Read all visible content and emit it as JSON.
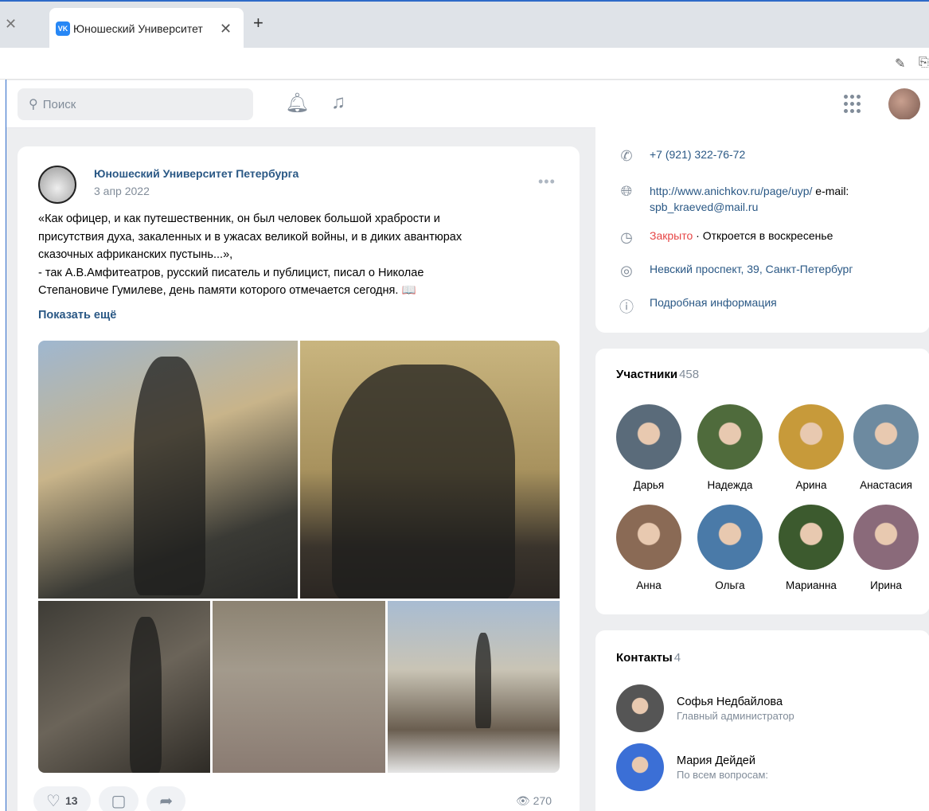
{
  "browser": {
    "tab_title": "Юношеский Университет",
    "tab_logo": "VK"
  },
  "header": {
    "search_placeholder": "Поиск"
  },
  "post": {
    "author": "Юношеский Университет Петербурга",
    "date": "3 апр 2022",
    "text_lines": [
      "«Как офицер, и как путешественник, он был человек большой храбрости и",
      "присутствия духа, закаленных и в ужасах великой войны, и в диких авантюрах",
      "сказочных африканских пустынь...»,",
      "- так А.В.Амфитеатров, русский писатель и публицист, писал о Николае",
      "Степановиче Гумилеве, день памяти которого отмечается сегодня. 📖"
    ],
    "show_more": "Показать ещё",
    "likes": "13",
    "views": "270"
  },
  "info": {
    "phone": "+7 (921) 322-76-72",
    "site": "http://www.anichkov.ru/page/uyp/",
    "email_label": " e-mail:",
    "email": "spb_kraeved@mail.ru",
    "status_closed": "Закрыто",
    "status_rest": " · Откроется в воскресенье",
    "address": "Невский проспект, 39, Санкт-Петербург",
    "more_info": "Подробная информация"
  },
  "members": {
    "title": "Участники",
    "count": "458",
    "items": [
      {
        "name": "Дарья",
        "color": "#5a6b7a"
      },
      {
        "name": "Надежда",
        "color": "#4f6b3c"
      },
      {
        "name": "Арина",
        "color": "#c79a3a"
      },
      {
        "name": "Анастасия",
        "color": "#6d8aa0"
      },
      {
        "name": "Анна",
        "color": "#8a6a55"
      },
      {
        "name": "Ольга",
        "color": "#4a7aa8"
      },
      {
        "name": "Марианна",
        "color": "#3c5a2e"
      },
      {
        "name": "Ирина",
        "color": "#8a6a7a"
      }
    ]
  },
  "contacts": {
    "title": "Контакты",
    "count": "4",
    "items": [
      {
        "name": "Софья Недбайлова",
        "role": "Главный администратор",
        "color": "#555555"
      },
      {
        "name": "Мария Дейдей",
        "role": "По всем вопросам:",
        "color": "#3b6fd6"
      }
    ]
  }
}
